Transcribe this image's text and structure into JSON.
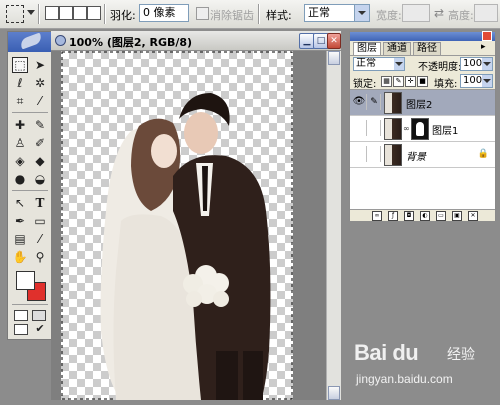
{
  "options_bar": {
    "feather_label": "羽化:",
    "feather_value": "0 像素",
    "antialias_label": "消除锯齿",
    "style_label": "样式:",
    "style_value": "正常",
    "width_label": "宽度:",
    "height_label": "高度:"
  },
  "document": {
    "title": "100% (图层2, RGB/8)"
  },
  "layers_panel": {
    "tabs": [
      "图层",
      "通道",
      "路径"
    ],
    "blend_mode": "正常",
    "opacity_label": "不透明度:",
    "opacity_value": "100%",
    "lock_label": "锁定:",
    "fill_label": "填充:",
    "fill_value": "100%",
    "layers": [
      {
        "name": "图层2",
        "visible": true,
        "selected": true
      },
      {
        "name": "图层1",
        "visible": false,
        "selected": false
      },
      {
        "name": "背景",
        "visible": false,
        "selected": false
      }
    ]
  },
  "toolbox": {
    "type_tool": "T",
    "foreground_color": "#ffffff",
    "background_color": "#e0302c"
  },
  "watermark": {
    "logo": "Bai du",
    "cn": "经验",
    "url": "jingyan.baidu.com"
  }
}
